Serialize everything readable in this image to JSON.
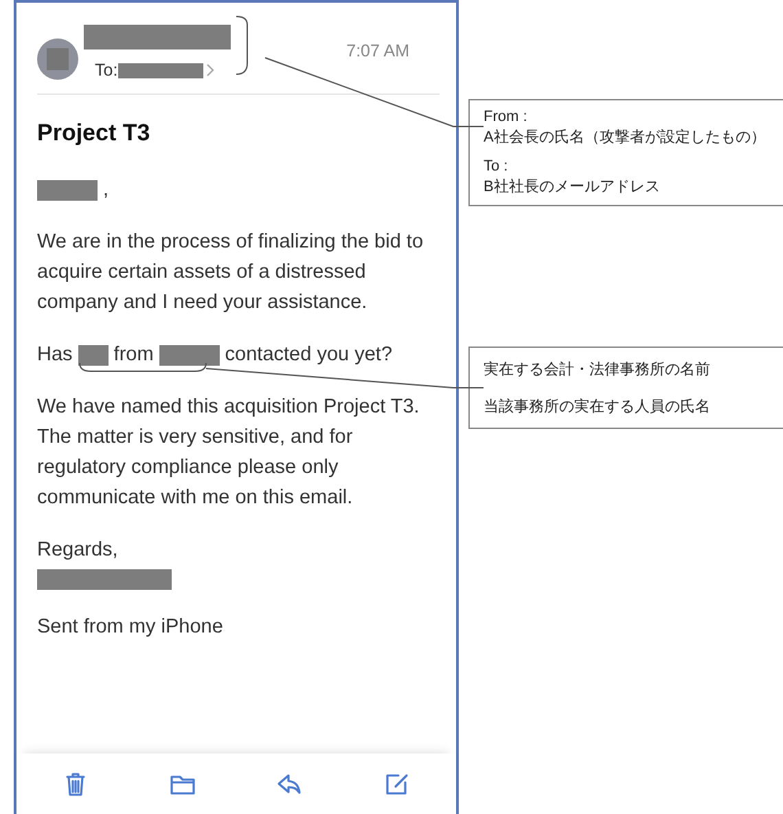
{
  "email": {
    "header": {
      "to_label": "To:",
      "time": "7:07 AM"
    },
    "subject": "Project T3",
    "body": [
      {
        "kind": "mixed",
        "segments": [
          {
            "kind": "redacted"
          },
          {
            "kind": "text",
            "text": ","
          }
        ]
      },
      {
        "kind": "text",
        "lines": [
          "We are in the process of finalizing the bid to",
          "acquire certain assets of a distressed",
          "company and I need your assistance."
        ]
      },
      {
        "kind": "mixed",
        "segments": [
          {
            "kind": "text",
            "text": "Has"
          },
          {
            "kind": "redacted"
          },
          {
            "kind": "text",
            "text": "from"
          },
          {
            "kind": "redacted"
          },
          {
            "kind": "text",
            "text": "contacted you yet?"
          }
        ]
      },
      {
        "kind": "text",
        "lines": [
          "We have named this acquisition Project T3.",
          "The matter is very sensitive, and for",
          "regulatory compliance please only",
          "communicate with me on this email."
        ]
      },
      {
        "kind": "signature",
        "text": "Regards,"
      },
      {
        "kind": "text",
        "lines": [
          "Sent from my iPhone"
        ]
      }
    ]
  },
  "annotations": [
    {
      "items": [
        {
          "label": "From :",
          "value": "A社会長の氏名（攻撃者が設定したもの）"
        },
        {
          "label": "To :",
          "value": "B社社長のメールアドレス"
        }
      ]
    },
    {
      "items": [
        {
          "value": "実在する会計・法律事務所の名前"
        },
        {
          "value": "当該事務所の実在する人員の氏名"
        }
      ]
    }
  ]
}
